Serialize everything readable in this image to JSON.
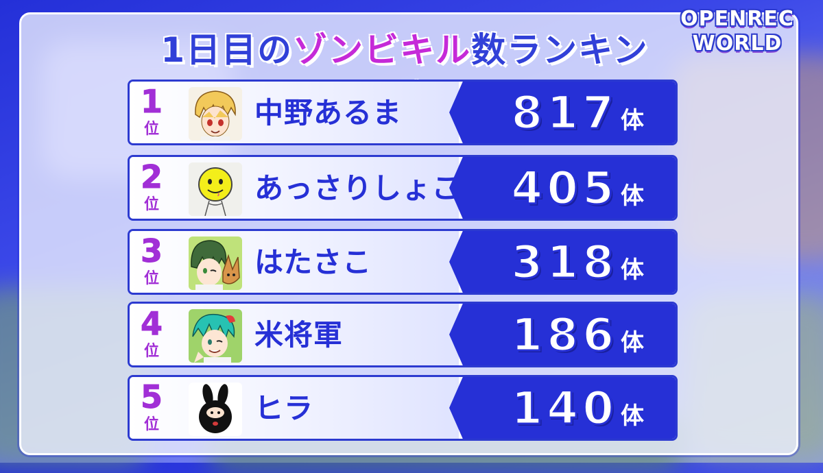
{
  "title": {
    "part1": "1日目の",
    "part2": "ゾンビキル",
    "part3": "数ランキング"
  },
  "logo": {
    "line1": "OPENREC",
    "line2": "WORLD"
  },
  "ranking": [
    {
      "rank": "1",
      "rank_suffix": "位",
      "name": "中野あるま",
      "count": "817",
      "unit": "体",
      "avatar": "blonde-boy-avatar"
    },
    {
      "rank": "2",
      "rank_suffix": "位",
      "name": "あっさりしょこ",
      "count": "405",
      "unit": "体",
      "avatar": "yellow-smiley-avatar"
    },
    {
      "rank": "3",
      "rank_suffix": "位",
      "name": "はたさこ",
      "count": "318",
      "unit": "体",
      "avatar": "green-hair-boy-with-fox-avatar"
    },
    {
      "rank": "4",
      "rank_suffix": "位",
      "name": "米将軍",
      "count": "186",
      "unit": "体",
      "avatar": "teal-hair-boy-avatar"
    },
    {
      "rank": "5",
      "rank_suffix": "位",
      "name": "ヒラ",
      "count": "140",
      "unit": "体",
      "avatar": "black-bunny-avatar"
    }
  ],
  "colors": {
    "accent_blue": "#2630d6",
    "rank_purple": "#a12fd6",
    "title_pink": "#c52ad8"
  }
}
